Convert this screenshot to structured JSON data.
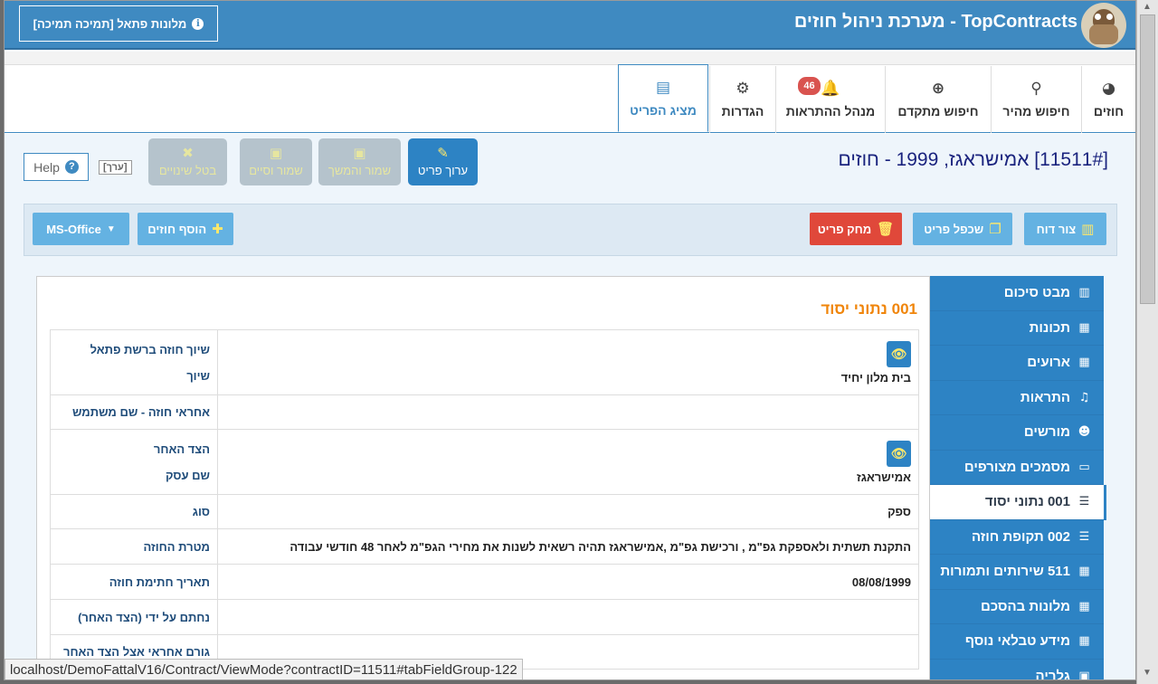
{
  "header": {
    "title": "TopContracts - מערכת ניהול חוזים",
    "brand_button": "מלונות פתאל [תמיכה תמיכה]"
  },
  "tabs": [
    {
      "label": "חוזים",
      "icon": "dashboard-icon"
    },
    {
      "label": "חיפוש מהיר",
      "icon": "search-icon"
    },
    {
      "label": "חיפוש מתקדם",
      "icon": "zoom-in-icon"
    },
    {
      "label": "מנהל ההתראות",
      "icon": "bell-icon",
      "badge": "46"
    },
    {
      "label": "הגדרות",
      "icon": "gear-icon"
    },
    {
      "label": "מציג הפריט",
      "icon": "book-icon",
      "active": true
    }
  ],
  "contract_title": "[11511#] אמישראגז, 1999 - חוזים",
  "actions": {
    "edit": "ערוך פריט",
    "save_continue": "שמור והמשך",
    "save_close": "שמור וסיים",
    "cancel": "בטל שינויים",
    "edit_label": "[ערך]",
    "help": "Help"
  },
  "toolbar": {
    "report": "צור דוח",
    "duplicate": "שכפל פריט",
    "delete": "מחק פריט",
    "add": "הוסף חוזים",
    "office": "MS-Office"
  },
  "section_title": "001 נתוני יסוד",
  "fields": [
    {
      "label": "שיוך חוזה ברשת פתאל",
      "label2": "שיוך",
      "value": "בית מלון יחיד",
      "eye": true
    },
    {
      "label": "אחראי חוזה - שם משתמש",
      "value": ""
    },
    {
      "label": "הצד האחר",
      "label2": "שם עסק",
      "value": "אמישראגז",
      "eye": true
    },
    {
      "label": "סוג",
      "value": "ספק"
    },
    {
      "label": "מטרת החוזה",
      "value": "התקנת תשתית ולאספקת גפ\"מ , ורכישת גפ\"מ ,אמישראגז תהיה רשאית לשנות את מחירי הגפ\"מ לאחר 48 חודשי עבודה"
    },
    {
      "label": "תאריך חתימת חוזה",
      "value": "08/08/1999"
    },
    {
      "label": "נחתם על ידי (הצד האחר)",
      "value": ""
    },
    {
      "label": "גורם אחראי אצל הצד האחר",
      "value": ""
    }
  ],
  "sidebar": [
    {
      "label": "מבט סיכום",
      "icon": "barcode-icon"
    },
    {
      "label": "תכונות",
      "icon": "grid-icon"
    },
    {
      "label": "ארועים",
      "icon": "calendar-icon"
    },
    {
      "label": "התראות",
      "icon": "bell-icon"
    },
    {
      "label": "מורשים",
      "icon": "users-icon"
    },
    {
      "label": "מסמכים מצורפים",
      "icon": "file-icon"
    },
    {
      "label": "001 נתוני יסוד",
      "icon": "list-icon",
      "active": true
    },
    {
      "label": "002 תקופת חוזה",
      "icon": "list-icon"
    },
    {
      "label": "511 שירותים ותמורות",
      "icon": "table-icon"
    },
    {
      "label": "מלונות בהסכם",
      "icon": "table-icon"
    },
    {
      "label": "מידע טבלאי נוסף",
      "icon": "table-icon"
    },
    {
      "label": "גלריה",
      "icon": "image-icon"
    }
  ],
  "status_url": "localhost/DemoFattalV16/Contract/ViewMode?contractID=11511#tabFieldGroup-122",
  "colors": {
    "primary": "#2d83c4",
    "header": "#3f8ac1",
    "accent_orange": "#f0850a",
    "danger": "#e0483a"
  }
}
